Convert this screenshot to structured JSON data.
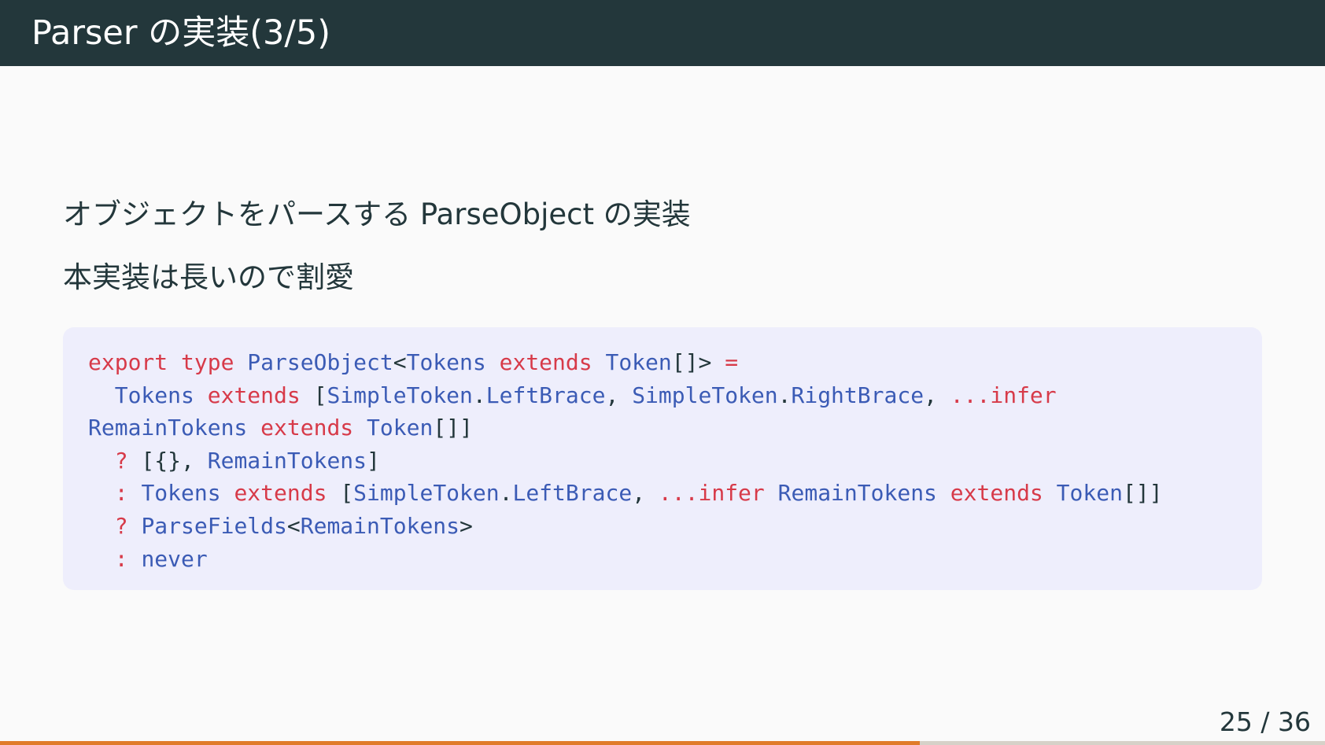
{
  "slide": {
    "title": "Parser の実装(3/5)",
    "paragraphs": [
      "オブジェクトをパースする ParseObject の実装",
      "本実装は長いので割愛"
    ],
    "page_number": "25 / 36",
    "progress_fraction": 0.6944
  },
  "code": {
    "lines": [
      [
        {
          "t": "export type ",
          "c": "kw"
        },
        {
          "t": "ParseObject",
          "c": "ty"
        },
        {
          "t": "<",
          "c": "pu"
        },
        {
          "t": "Tokens",
          "c": "ty"
        },
        {
          "t": " extends ",
          "c": "kw"
        },
        {
          "t": "Token",
          "c": "ty"
        },
        {
          "t": "[]> ",
          "c": "pu"
        },
        {
          "t": "=",
          "c": "kw"
        }
      ],
      [
        {
          "t": "  ",
          "c": "pu"
        },
        {
          "t": "Tokens",
          "c": "ty"
        },
        {
          "t": " extends ",
          "c": "kw"
        },
        {
          "t": "[",
          "c": "pu"
        },
        {
          "t": "SimpleToken",
          "c": "ty"
        },
        {
          "t": ".",
          "c": "pu"
        },
        {
          "t": "LeftBrace",
          "c": "ty"
        },
        {
          "t": ", ",
          "c": "pu"
        },
        {
          "t": "SimpleToken",
          "c": "ty"
        },
        {
          "t": ".",
          "c": "pu"
        },
        {
          "t": "RightBrace",
          "c": "ty"
        },
        {
          "t": ", ",
          "c": "pu"
        },
        {
          "t": "...infer",
          "c": "kw"
        }
      ],
      [
        {
          "t": "RemainTokens",
          "c": "ty"
        },
        {
          "t": " extends ",
          "c": "kw"
        },
        {
          "t": "Token",
          "c": "ty"
        },
        {
          "t": "[]]",
          "c": "pu"
        }
      ],
      [
        {
          "t": "  ",
          "c": "pu"
        },
        {
          "t": "?",
          "c": "kw"
        },
        {
          "t": " [{}, ",
          "c": "pu"
        },
        {
          "t": "RemainTokens",
          "c": "ty"
        },
        {
          "t": "]",
          "c": "pu"
        }
      ],
      [
        {
          "t": "  ",
          "c": "pu"
        },
        {
          "t": ":",
          "c": "kw"
        },
        {
          "t": " ",
          "c": "pu"
        },
        {
          "t": "Tokens",
          "c": "ty"
        },
        {
          "t": " extends ",
          "c": "kw"
        },
        {
          "t": "[",
          "c": "pu"
        },
        {
          "t": "SimpleToken",
          "c": "ty"
        },
        {
          "t": ".",
          "c": "pu"
        },
        {
          "t": "LeftBrace",
          "c": "ty"
        },
        {
          "t": ", ",
          "c": "pu"
        },
        {
          "t": "...infer",
          "c": "kw"
        },
        {
          "t": " ",
          "c": "pu"
        },
        {
          "t": "RemainTokens",
          "c": "ty"
        },
        {
          "t": " extends ",
          "c": "kw"
        },
        {
          "t": "Token",
          "c": "ty"
        },
        {
          "t": "[]]",
          "c": "pu"
        }
      ],
      [
        {
          "t": "  ",
          "c": "pu"
        },
        {
          "t": "?",
          "c": "kw"
        },
        {
          "t": " ",
          "c": "pu"
        },
        {
          "t": "ParseFields",
          "c": "ty"
        },
        {
          "t": "<",
          "c": "pu"
        },
        {
          "t": "RemainTokens",
          "c": "ty"
        },
        {
          "t": ">",
          "c": "pu"
        }
      ],
      [
        {
          "t": "  ",
          "c": "pu"
        },
        {
          "t": ":",
          "c": "kw"
        },
        {
          "t": " ",
          "c": "pu"
        },
        {
          "t": "never",
          "c": "ty"
        }
      ]
    ]
  },
  "colors": {
    "title_bar_bg": "#23373b",
    "body_bg": "#fafafa",
    "code_bg": "#eeeefc",
    "keyword": "#d73a49",
    "type_name": "#3b5bb5",
    "progress_fill": "#e07b2a",
    "progress_track": "#d6d1c8"
  }
}
